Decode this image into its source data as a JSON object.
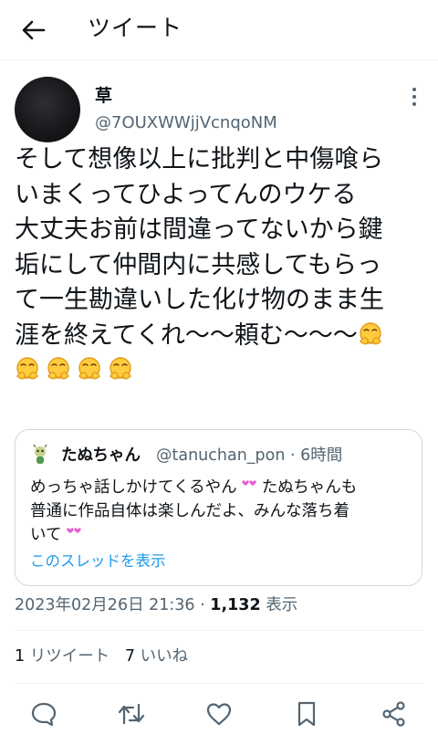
{
  "header": {
    "title": "ツイート",
    "back_icon": "arrow-left-icon"
  },
  "author": {
    "name": "草",
    "handle": "@7OUXWWjjVcnqoNM"
  },
  "tweet": {
    "lines": [
      "そして想像以上に批判と中傷喰ら",
      "いまくってひよってんのウケる",
      "大丈夫お前は間違ってないから鍵",
      "垢にして仲間内に共感してもらっ",
      "て一生勘違いした化け物のまま生",
      "涯を終えてくれ〜〜頼む〜〜〜"
    ],
    "emoji": "face-with-hands-over-face-emoji",
    "emoji_count": 5
  },
  "quote": {
    "name": "たぬちゃん",
    "handle_time": "@tanuchan_pon · 6時間",
    "line1": "めっちゃ話しかけてくるやん",
    "line1b": " たぬちゃんも",
    "line2": "普通に作品自体は楽しんだよ、みんな落ち着",
    "line3": "いて",
    "heart_emoji": "pink-hearts-emoji",
    "link": "このスレッドを表示"
  },
  "meta": {
    "datetime": "2023年02月26日 21:36 · ",
    "views": "1,132",
    "views_label": " 表示"
  },
  "stats": {
    "retweets": "1",
    "retweets_label": " リツイート",
    "likes": "7",
    "likes_label": " いいね"
  },
  "actions": [
    "reply-icon",
    "retweet-icon",
    "like-icon",
    "bookmark-icon",
    "share-icon"
  ],
  "colors": {
    "link": "#1d9bf0",
    "muted": "#536471",
    "text": "#0f1419",
    "emoji": "#f8b526"
  }
}
